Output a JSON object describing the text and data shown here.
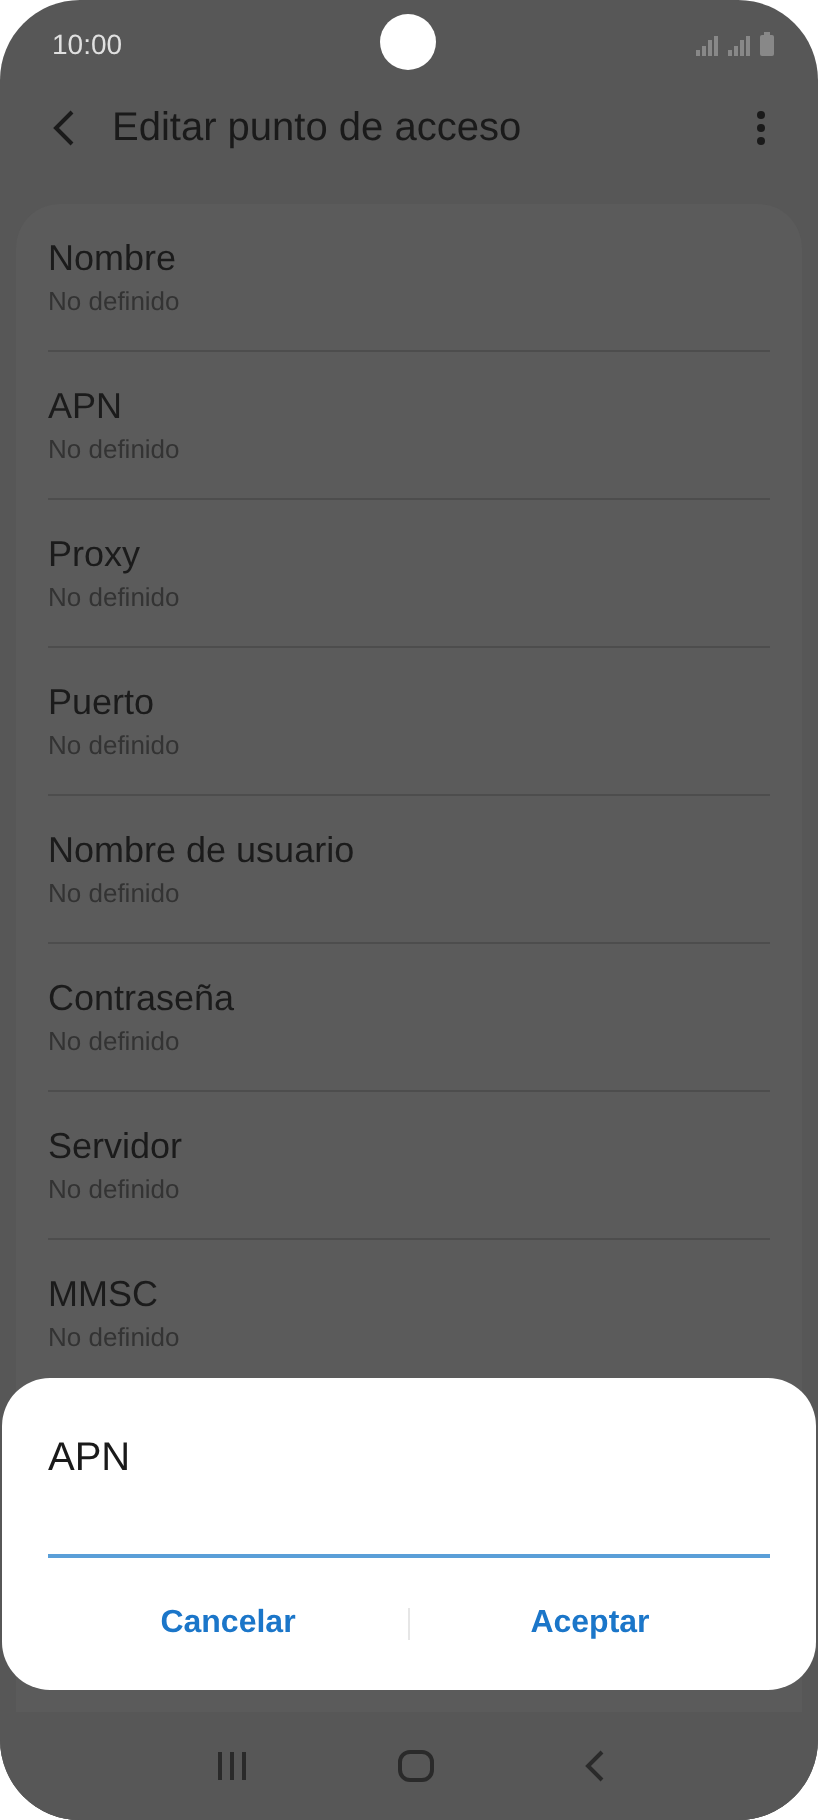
{
  "status_bar": {
    "time": "10:00"
  },
  "header": {
    "title": "Editar punto de acceso"
  },
  "settings": [
    {
      "title": "Nombre",
      "value": "No definido"
    },
    {
      "title": "APN",
      "value": "No definido"
    },
    {
      "title": "Proxy",
      "value": "No definido"
    },
    {
      "title": "Puerto",
      "value": "No definido"
    },
    {
      "title": "Nombre de usuario",
      "value": "No definido"
    },
    {
      "title": "Contraseña",
      "value": "No definido"
    },
    {
      "title": "Servidor",
      "value": "No definido"
    },
    {
      "title": "MMSC",
      "value": "No definido"
    }
  ],
  "dialog": {
    "title": "APN",
    "buttons": [
      "Cancelar",
      "Aceptar"
    ]
  }
}
